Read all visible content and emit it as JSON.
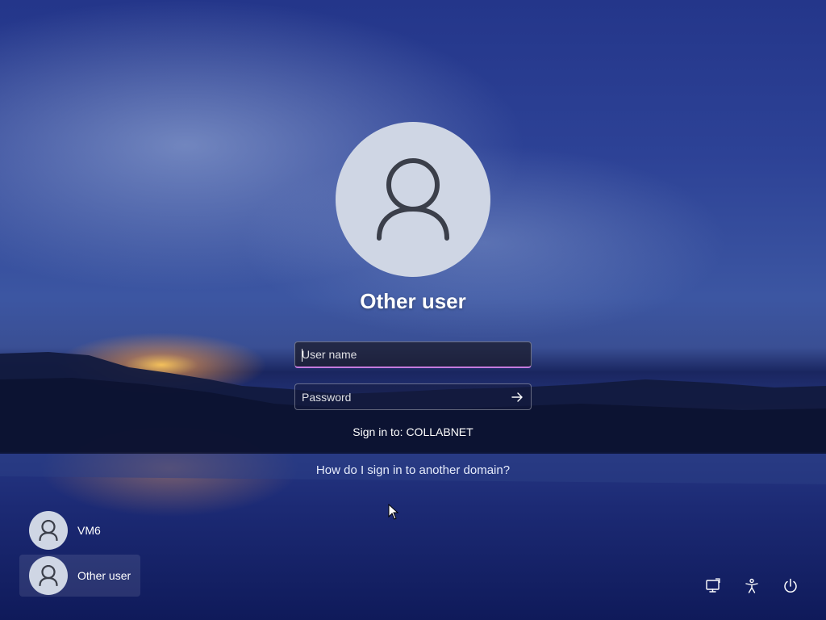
{
  "selected_user": {
    "name": "Other user"
  },
  "login_form": {
    "username_placeholder": "User name",
    "password_placeholder": "Password",
    "sign_in_to": "Sign in to: COLLABNET",
    "domain_help_link": "How do I sign in to another domain?"
  },
  "user_list": [
    {
      "label": "VM6",
      "icon": "user-avatar-icon"
    },
    {
      "label": "Other user",
      "icon": "user-avatar-icon",
      "selected": true
    }
  ],
  "corner_controls": [
    {
      "icon": "network-icon"
    },
    {
      "icon": "accessibility-icon"
    },
    {
      "icon": "power-icon"
    }
  ],
  "colors": {
    "focus_underline": "#c57adf",
    "avatar_bg": "#cfd6e4",
    "avatar_glyph": "#3b3f4a"
  }
}
